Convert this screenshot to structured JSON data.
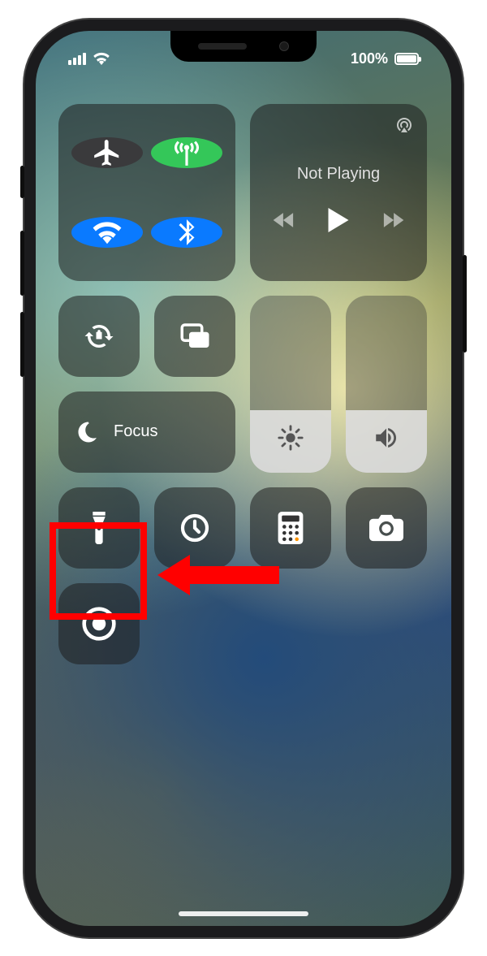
{
  "status": {
    "signal_bars": 4,
    "battery_percent_label": "100%",
    "battery_fill_percent": 100
  },
  "media": {
    "title": "Not Playing"
  },
  "focus": {
    "label": "Focus"
  },
  "sliders": {
    "brightness_percent": 35,
    "volume_percent": 35
  },
  "colors": {
    "airplane_off": "#3a3a3c",
    "cellular_on": "#34c759",
    "wifi_on": "#0a7aff",
    "bluetooth_on": "#0a7aff",
    "highlight": "#ff0000"
  },
  "icons": {
    "airplane": "airplane-icon",
    "cellular": "cellular-antenna-icon",
    "wifi": "wifi-icon",
    "bluetooth": "bluetooth-icon",
    "airplay": "airplay-icon",
    "back": "backward-icon",
    "play": "play-icon",
    "forward": "forward-icon",
    "orientation_lock": "orientation-lock-icon",
    "mirror": "screen-mirroring-icon",
    "moon": "moon-icon",
    "brightness": "brightness-icon",
    "volume": "volume-icon",
    "flashlight": "flashlight-icon",
    "timer": "timer-icon",
    "calculator": "calculator-icon",
    "camera": "camera-icon",
    "record": "screen-record-icon"
  }
}
